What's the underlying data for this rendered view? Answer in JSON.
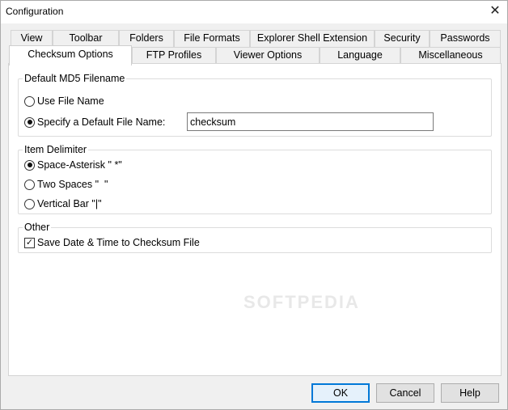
{
  "window": {
    "title": "Configuration",
    "close_glyph": "✕"
  },
  "tabs": {
    "row1": [
      {
        "label": "View"
      },
      {
        "label": "Toolbar"
      },
      {
        "label": "Folders"
      },
      {
        "label": "File Formats"
      },
      {
        "label": "Explorer Shell Extension"
      },
      {
        "label": "Security"
      },
      {
        "label": "Passwords"
      }
    ],
    "row2": [
      {
        "label": "Checksum Options",
        "selected": true
      },
      {
        "label": "FTP Profiles"
      },
      {
        "label": "Viewer Options"
      },
      {
        "label": "Language"
      },
      {
        "label": "Miscellaneous"
      }
    ]
  },
  "default_md5": {
    "label": "Default MD5 Filename",
    "option_use_file_name": "Use File Name",
    "option_specify": "Specify a Default File Name:",
    "selected": "specify",
    "default_file_name": "checksum"
  },
  "item_delimiter": {
    "label": "Item Delimiter",
    "option_space_asterisk": "Space-Asterisk \" *\"",
    "option_two_spaces": "Two Spaces \"  \"",
    "option_vertical_bar": "Vertical Bar \"|\"",
    "selected": "space_asterisk"
  },
  "other": {
    "label": "Other",
    "save_date_time_label": "Save Date & Time to Checksum File",
    "save_date_time_checked": true
  },
  "buttons": {
    "ok": "OK",
    "cancel": "Cancel",
    "help": "Help"
  },
  "watermark": "SOFTPEDIA",
  "icons": {
    "close": "close-icon",
    "check": "checkmark-icon"
  }
}
